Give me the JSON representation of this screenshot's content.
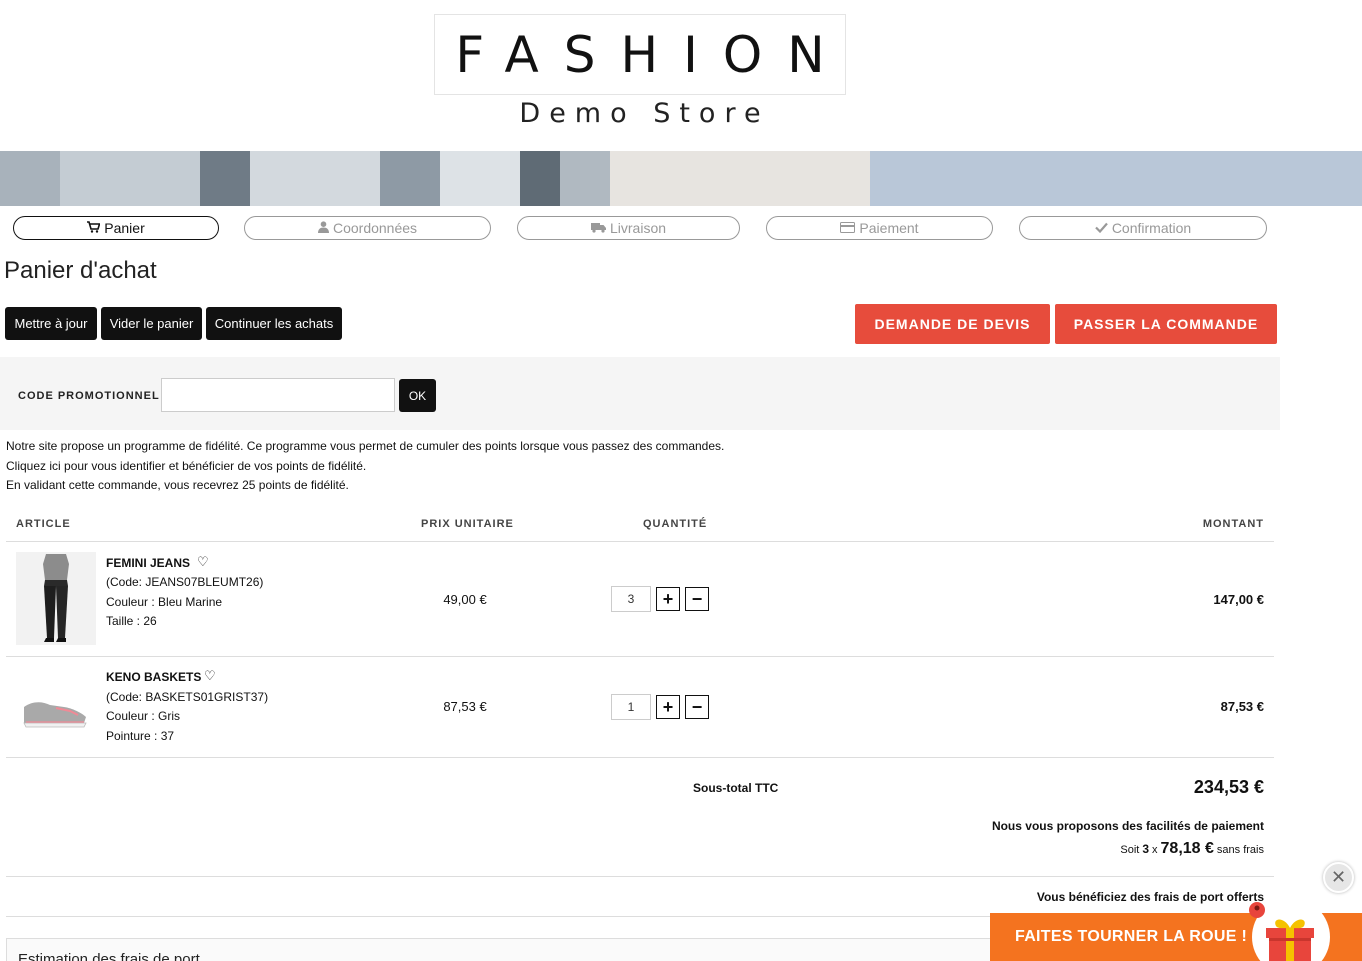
{
  "header": {
    "logo_title": "FASHION",
    "logo_subtitle": "Demo Store"
  },
  "steps": [
    {
      "label": "Panier",
      "icon": "cart-icon",
      "active": true
    },
    {
      "label": "Coordonnées",
      "icon": "user-icon",
      "active": false
    },
    {
      "label": "Livraison",
      "icon": "truck-icon",
      "active": false
    },
    {
      "label": "Paiement",
      "icon": "credit-card-icon",
      "active": false
    },
    {
      "label": "Confirmation",
      "icon": "check-icon",
      "active": false
    }
  ],
  "page_title": "Panier d'achat",
  "actions": {
    "update": "Mettre à jour",
    "empty": "Vider le panier",
    "continue": "Continuer les achats",
    "quote": "DEMANDE DE DEVIS",
    "checkout": "PASSER LA COMMANDE"
  },
  "promo": {
    "label": "CODE PROMOTIONNEL :",
    "value": "",
    "ok": "OK"
  },
  "loyalty": [
    "Notre site propose un programme de fidélité. Ce programme vous permet de cumuler des points lorsque vous passez des commandes.",
    "Cliquez ici pour vous identifier et bénéficier de vos points de fidélité.",
    "En validant cette commande, vous recevrez 25 points de fidélité."
  ],
  "table": {
    "headers": {
      "article": "ARTICLE",
      "unit_price": "PRIX UNITAIRE",
      "quantity": "QUANTITÉ",
      "amount": "MONTANT"
    },
    "rows": [
      {
        "name": "FEMINI JEANS",
        "code": "(Code: JEANS07BLEUMT26)",
        "attr1": "Couleur : Bleu Marine",
        "attr2": "Taille : 26",
        "unit_price": "49,00 €",
        "quantity": "3",
        "amount": "147,00 €"
      },
      {
        "name": "KENO BASKETS",
        "code": "(Code: BASKETS01GRIST37)",
        "attr1": "Couleur : Gris",
        "attr2": "Pointure : 37",
        "unit_price": "87,53 €",
        "quantity": "1",
        "amount": "87,53 €"
      }
    ]
  },
  "totals": {
    "subtotal_label": "Sous-total TTC",
    "subtotal_value": "234,53 €",
    "payment_title": "Nous vous proposons des facilités de paiement",
    "payment_prefix": "Soit",
    "payment_count": "3",
    "payment_x": "x",
    "payment_amount": "78,18 €",
    "payment_suffix": "sans frais",
    "shipping_free": "Vous bénéficiez des frais de port offerts"
  },
  "shipping_estimate": "Estimation des frais de port",
  "wheel": {
    "label": "FAITES TOURNER LA ROUE !"
  },
  "colors": {
    "accent_red": "#e74c3c",
    "wheel_orange": "#f4731f",
    "dark": "#111111"
  }
}
